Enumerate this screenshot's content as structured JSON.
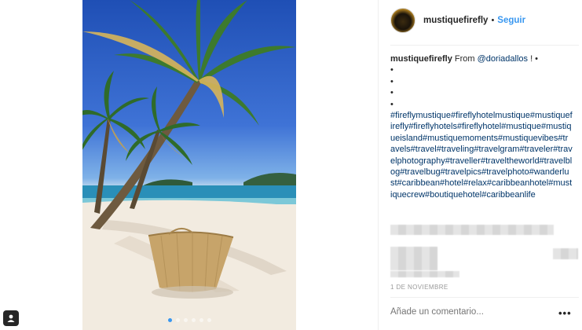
{
  "post": {
    "username": "mustiquefirefly",
    "separator": "•",
    "follow_label": "Seguir",
    "caption": {
      "username": "mustiquefirefly",
      "text_before": " From ",
      "mention": "@doriadallos",
      "text_after": " ! •",
      "bullets": [
        "•",
        "•",
        "•",
        "•"
      ],
      "hashtags": "#fireflymustique#fireflyhotelmustique#mustiquefirefly#fireflyhotels#fireflyhotel#mustique#mustiqueisland#mustiquemoments#mustiquevibes#travels#travel#traveling#travelgram#traveler#travelphotography#traveller#traveltheworld#travelblog#travelbug#travelpics#travelphoto#wanderlust#caribbean#hotel#relax#caribbeanhotel#mustiquecrew#boutiquehotel#caribbeanlife"
    },
    "date": "1 DE NOVIEMBRE",
    "comment_placeholder": "Añade un comentario...",
    "more_label": "•••"
  },
  "carousel": {
    "count": 6,
    "active_index": 0
  },
  "icons": {
    "tag": "person-tag-icon",
    "more": "more-options-icon"
  },
  "colors": {
    "link": "#3897f0",
    "hashtag": "#003569",
    "muted": "#999999",
    "text": "#262626"
  }
}
